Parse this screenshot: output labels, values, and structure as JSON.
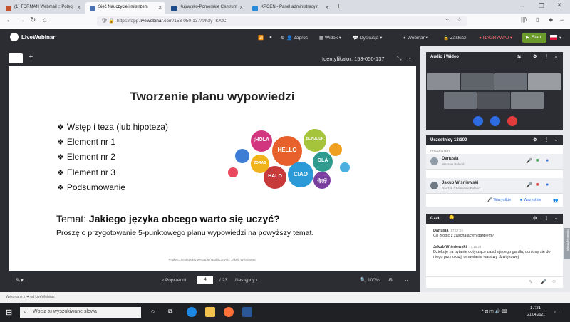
{
  "browser": {
    "tabs": [
      {
        "label": "(1) TORMAN Webmail :: Polecj"
      },
      {
        "label": "Sieć Nauczycieli mistrzem"
      },
      {
        "label": "Kujawsko-Pomorskie Centrum"
      },
      {
        "label": "KPCEN - Panel administracyjn"
      }
    ],
    "url_prefix": "https://app.",
    "url_domain": "livewebinar",
    "url_rest": ".com/153-050-137/s/h3yTKXtC"
  },
  "header": {
    "logo": "LiveWebinar",
    "invite": "Zaproś",
    "view": "Widok",
    "discussion": "Dyskusja",
    "webinar": "Webinar",
    "lock": "Zakłucz",
    "record": "NAGRYWAJ",
    "start": "Start"
  },
  "session": {
    "id_label": "Identyfikator: 153-050-137"
  },
  "slide": {
    "title": "Tworzenie planu wypowiedzi",
    "bullets": [
      "Wstęp i teza (lub hipoteza)",
      "Element nr 1",
      "Element nr 2",
      "Element nr 3",
      "Podsumowanie"
    ],
    "bullet_symbol": "❖",
    "topic_prefix": "Temat:",
    "topic": "Jakiego języka obcego warto się uczyć?",
    "instruction": "Proszę o przygotowanie 5-punktowego planu wypowiedzi na powyższy temat.",
    "footer": "Praktyczne aspekty wystąpień publicznych, Jakub Wiśniewski",
    "bubbles": [
      "¡HOLA",
      "HELLO",
      "BONJOUR",
      "OLÁ",
      "CIAO",
      "HALO",
      "你好",
      "ZDRAS"
    ]
  },
  "pager": {
    "prev": "‹ Poprzedni",
    "page": "4",
    "total": "/ 23",
    "next": "Następny ›",
    "zoom": "100%"
  },
  "audio_video": {
    "title": "Audio i Wideo"
  },
  "participants": {
    "title": "Uczestnicy 13/100",
    "presenter_label": "PREZENTER",
    "list": [
      {
        "name": "Danusia",
        "location": "Warsaw Poland"
      },
      {
        "name": "Jakub Wiśniewski",
        "location": "Radzyń Chełmiński Poland"
      }
    ],
    "all_label_1": "Wszystkie",
    "all_label_2": "Wszystkie"
  },
  "chat": {
    "title": "Czat",
    "messages": [
      {
        "author": "Danusia",
        "time": "17:17:24",
        "text": "Co zrobić z zaschającym gardłem?"
      },
      {
        "author": "Jakub Wiśniewski",
        "time": "17:18:24",
        "text": "Dziękuję za pytanie dotyczące zaschającego gardła, odniosę się do niego przy okazji omawiania warstwy dźwiękowej"
      }
    ],
    "side_tab": "Notatki Dyskusja"
  },
  "status": {
    "powered": "Wykonane z ❤ od LiveWebinar"
  },
  "taskbar": {
    "search_placeholder": "Wpisz tu wyszukiwane słowa",
    "time": "17:21",
    "date": "21.04.2021"
  },
  "colors": {
    "accent_green": "#6a9a2a",
    "dark_panel": "#2b2d33",
    "record_red": "#e23b3b"
  }
}
